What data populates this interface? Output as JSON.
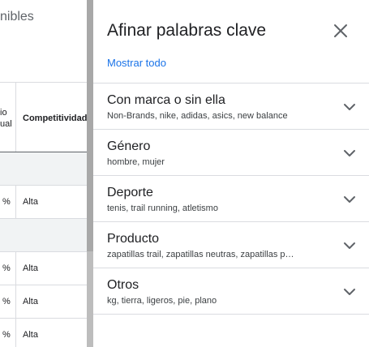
{
  "background": {
    "header_text": "nibles",
    "table": {
      "col1_header_lines": [
        "io",
        "ual"
      ],
      "col2_header": "Competitividad",
      "rows": [
        {
          "type": "group"
        },
        {
          "type": "row",
          "pct": "%",
          "level": "Alta"
        },
        {
          "type": "group"
        },
        {
          "type": "row",
          "pct": "%",
          "level": "Alta"
        },
        {
          "type": "row",
          "pct": "%",
          "level": "Alta"
        },
        {
          "type": "row",
          "pct": "%",
          "level": "Alta"
        }
      ]
    }
  },
  "drawer": {
    "title": "Afinar palabras clave",
    "close_icon": "close-icon",
    "show_all": "Mostrar todo",
    "sections": [
      {
        "title": "Con marca o sin ella",
        "subtitle": "Non-Brands, nike, adidas, asics, new balance"
      },
      {
        "title": "Género",
        "subtitle": "hombre, mujer"
      },
      {
        "title": "Deporte",
        "subtitle": "tenis, trail running, atletismo"
      },
      {
        "title": "Producto",
        "subtitle": "zapatillas trail, zapatillas neutras, zapatillas p…"
      },
      {
        "title": "Otros",
        "subtitle": "kg, tierra, ligeros, pie, plano"
      }
    ]
  },
  "colors": {
    "link": "#1a73e8",
    "divider": "#dadce0",
    "text": "#202124",
    "icon": "#5f6368"
  }
}
